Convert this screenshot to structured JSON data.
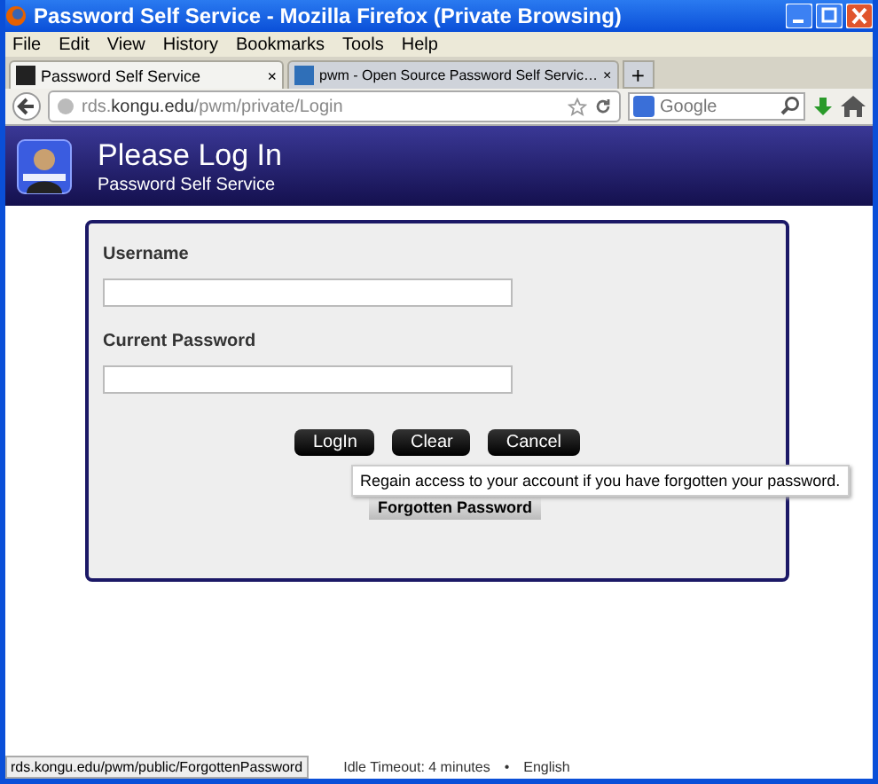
{
  "window": {
    "title": "Password Self Service - Mozilla Firefox (Private Browsing)"
  },
  "menu": [
    "File",
    "Edit",
    "View",
    "History",
    "Bookmarks",
    "Tools",
    "Help"
  ],
  "tabs": [
    {
      "label": "Password Self Service",
      "close": "×",
      "selected": true
    },
    {
      "label": "pwm - Open Source Password Self Servic…",
      "close": "×",
      "selected": false
    }
  ],
  "new_tab": "+",
  "address": {
    "url": "rds.**kongu.edu**/pwm/private/Login"
  },
  "search": {
    "placeholder": "Google"
  },
  "header": {
    "title": "Please Log In",
    "subtitle": "Password Self Service"
  },
  "form": {
    "fields": [
      {
        "label": "Username"
      },
      {
        "label": "Current Password"
      }
    ],
    "buttons": [
      "LogIn",
      "Clear",
      "Cancel"
    ],
    "tooltip": "Regain access to your account if you have forgotten your password.",
    "forgotten_button": "Forgotten Password"
  },
  "footer": {
    "idle": "Idle Timeout: 4 minutes",
    "separator": "•",
    "language": "English"
  },
  "status_url": "rds.kongu.edu/pwm/public/ForgottenPassword"
}
